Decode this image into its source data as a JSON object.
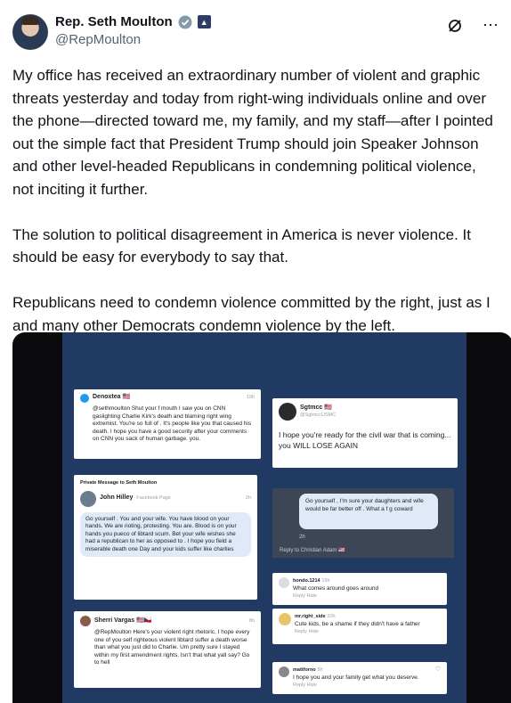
{
  "header": {
    "name": "Rep. Seth Moulton",
    "handle": "@RepMoulton",
    "grok_icon": "slash-circle-icon",
    "more_icon": "more-icon"
  },
  "tweet": {
    "p1": "My office has received an extraordinary number of violent and graphic threats yesterday and today from right-wing individuals online and over the phone—directed toward me, my family, and my staff—after I pointed out the simple fact that President Trump should join Speaker Johnson and other level-headed Republicans in condemning political violence, not inciting it further.",
    "p2": "The solution to political disagreement in America is never violence. It should be easy for everybody to say that.",
    "p3": "Republicans need to condemn violence committed by the right, just as I and many other Democrats condemn violence by the left."
  },
  "media": {
    "c1": {
      "name": "Denoxtea 🇺🇸",
      "time": "10h",
      "text": "@sethmoulton Shut your f mouth I saw you on CNN gaslighting Charlie Kirk's death and blaming right wing extremist. You're so full of . It's people like you that caused his death. I hope you have a good security after your comments on CNN you sack of human garbage. you."
    },
    "c2": {
      "name": "Sgtmcc 🇺🇸",
      "handle": "@SgtmccUSMC",
      "text": "I hope you're ready for the civil war that is coming... you WILL LOSE AGAIN"
    },
    "c3": {
      "caption": "Private Message to Seth Moulton",
      "name": "John Hilley",
      "meta": "Facebook Page",
      "time": "2h",
      "text": "Go yourself . You and your wife. You have blood on your hands. We are rioting, protesting. You are. Blood is on your hands you pueco of libtard scum. Bet your wife wishes she had a republican to her as opposed to . I hope you field a miserable death one Day and your kids suffer like charlies"
    },
    "c4": {
      "text": "Go yourself , I'm sure your daughters and wife would be far better off . What a f g coward",
      "time": "2h",
      "reply": "Reply to Christian Adam 🇺🇸"
    },
    "c5": {
      "name": "hondo.1214",
      "time": "19h",
      "text": "What comes around goes around",
      "actions": "Reply   Hide"
    },
    "c6": {
      "name": "mr.right_side",
      "time": "10h",
      "text": "Cute kids, be a shame if they didn't have a father",
      "actions": "Reply   Hide"
    },
    "c7": {
      "name": "Sherri Vargas 🇺🇸🇨🇿",
      "time": "8h",
      "text": "@RepMoulton Here's your violent right rhetoric, I hope every one of you self righteous violent libtard suffer a death worse than what you just did to Charlie. Um pretty sure I stayed within my first amendment rights. Isn't that what yall say? Go to hell"
    },
    "c8": {
      "name": "mattforno",
      "time": "5h",
      "text": "I hope you and your family get what you deserve.",
      "actions": "Reply   Hide"
    }
  }
}
